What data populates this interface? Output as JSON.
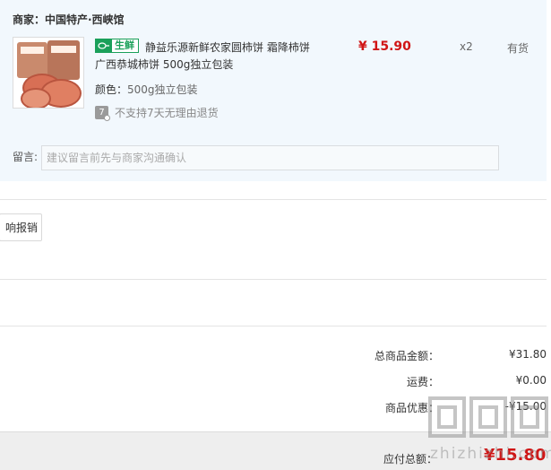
{
  "seller": {
    "label": "商家：中国特产·西峡馆"
  },
  "item": {
    "fresh_tag": "生鲜",
    "title_line1": "静益乐源新鲜农家圆柿饼 霜降柿饼",
    "title_line2": "广西恭城柿饼 500g独立包装",
    "price": "¥ 15.90",
    "quantity": "x2",
    "stock_status": "有货",
    "color_label": "颜色：",
    "color_value": "500g独立包装",
    "no_return_icon": "7",
    "no_return_text": "不支持7天无理由退货"
  },
  "message": {
    "label": "留言:",
    "placeholder": "建议留言前先与商家沟通确认"
  },
  "invoice": {
    "button_label": "响报销"
  },
  "summary": {
    "goods_total_label": "总商品金额：",
    "goods_total_value": "¥31.80",
    "shipping_label": "运费：",
    "shipping_value": "¥0.00",
    "discount_label": "商品优惠：",
    "discount_value": "-¥15.00"
  },
  "total": {
    "label": "应付总额：",
    "value": "¥15.80"
  },
  "watermark": {
    "text": "zhizhizhi.com"
  },
  "colors": {
    "price_red": "#d01515",
    "fresh_green": "#1aa05a",
    "panel_bg": "#f2f8fd"
  },
  "icons": {
    "fresh_tag_icon": "tray-icon",
    "no_return_icon": "no-return-icon"
  }
}
